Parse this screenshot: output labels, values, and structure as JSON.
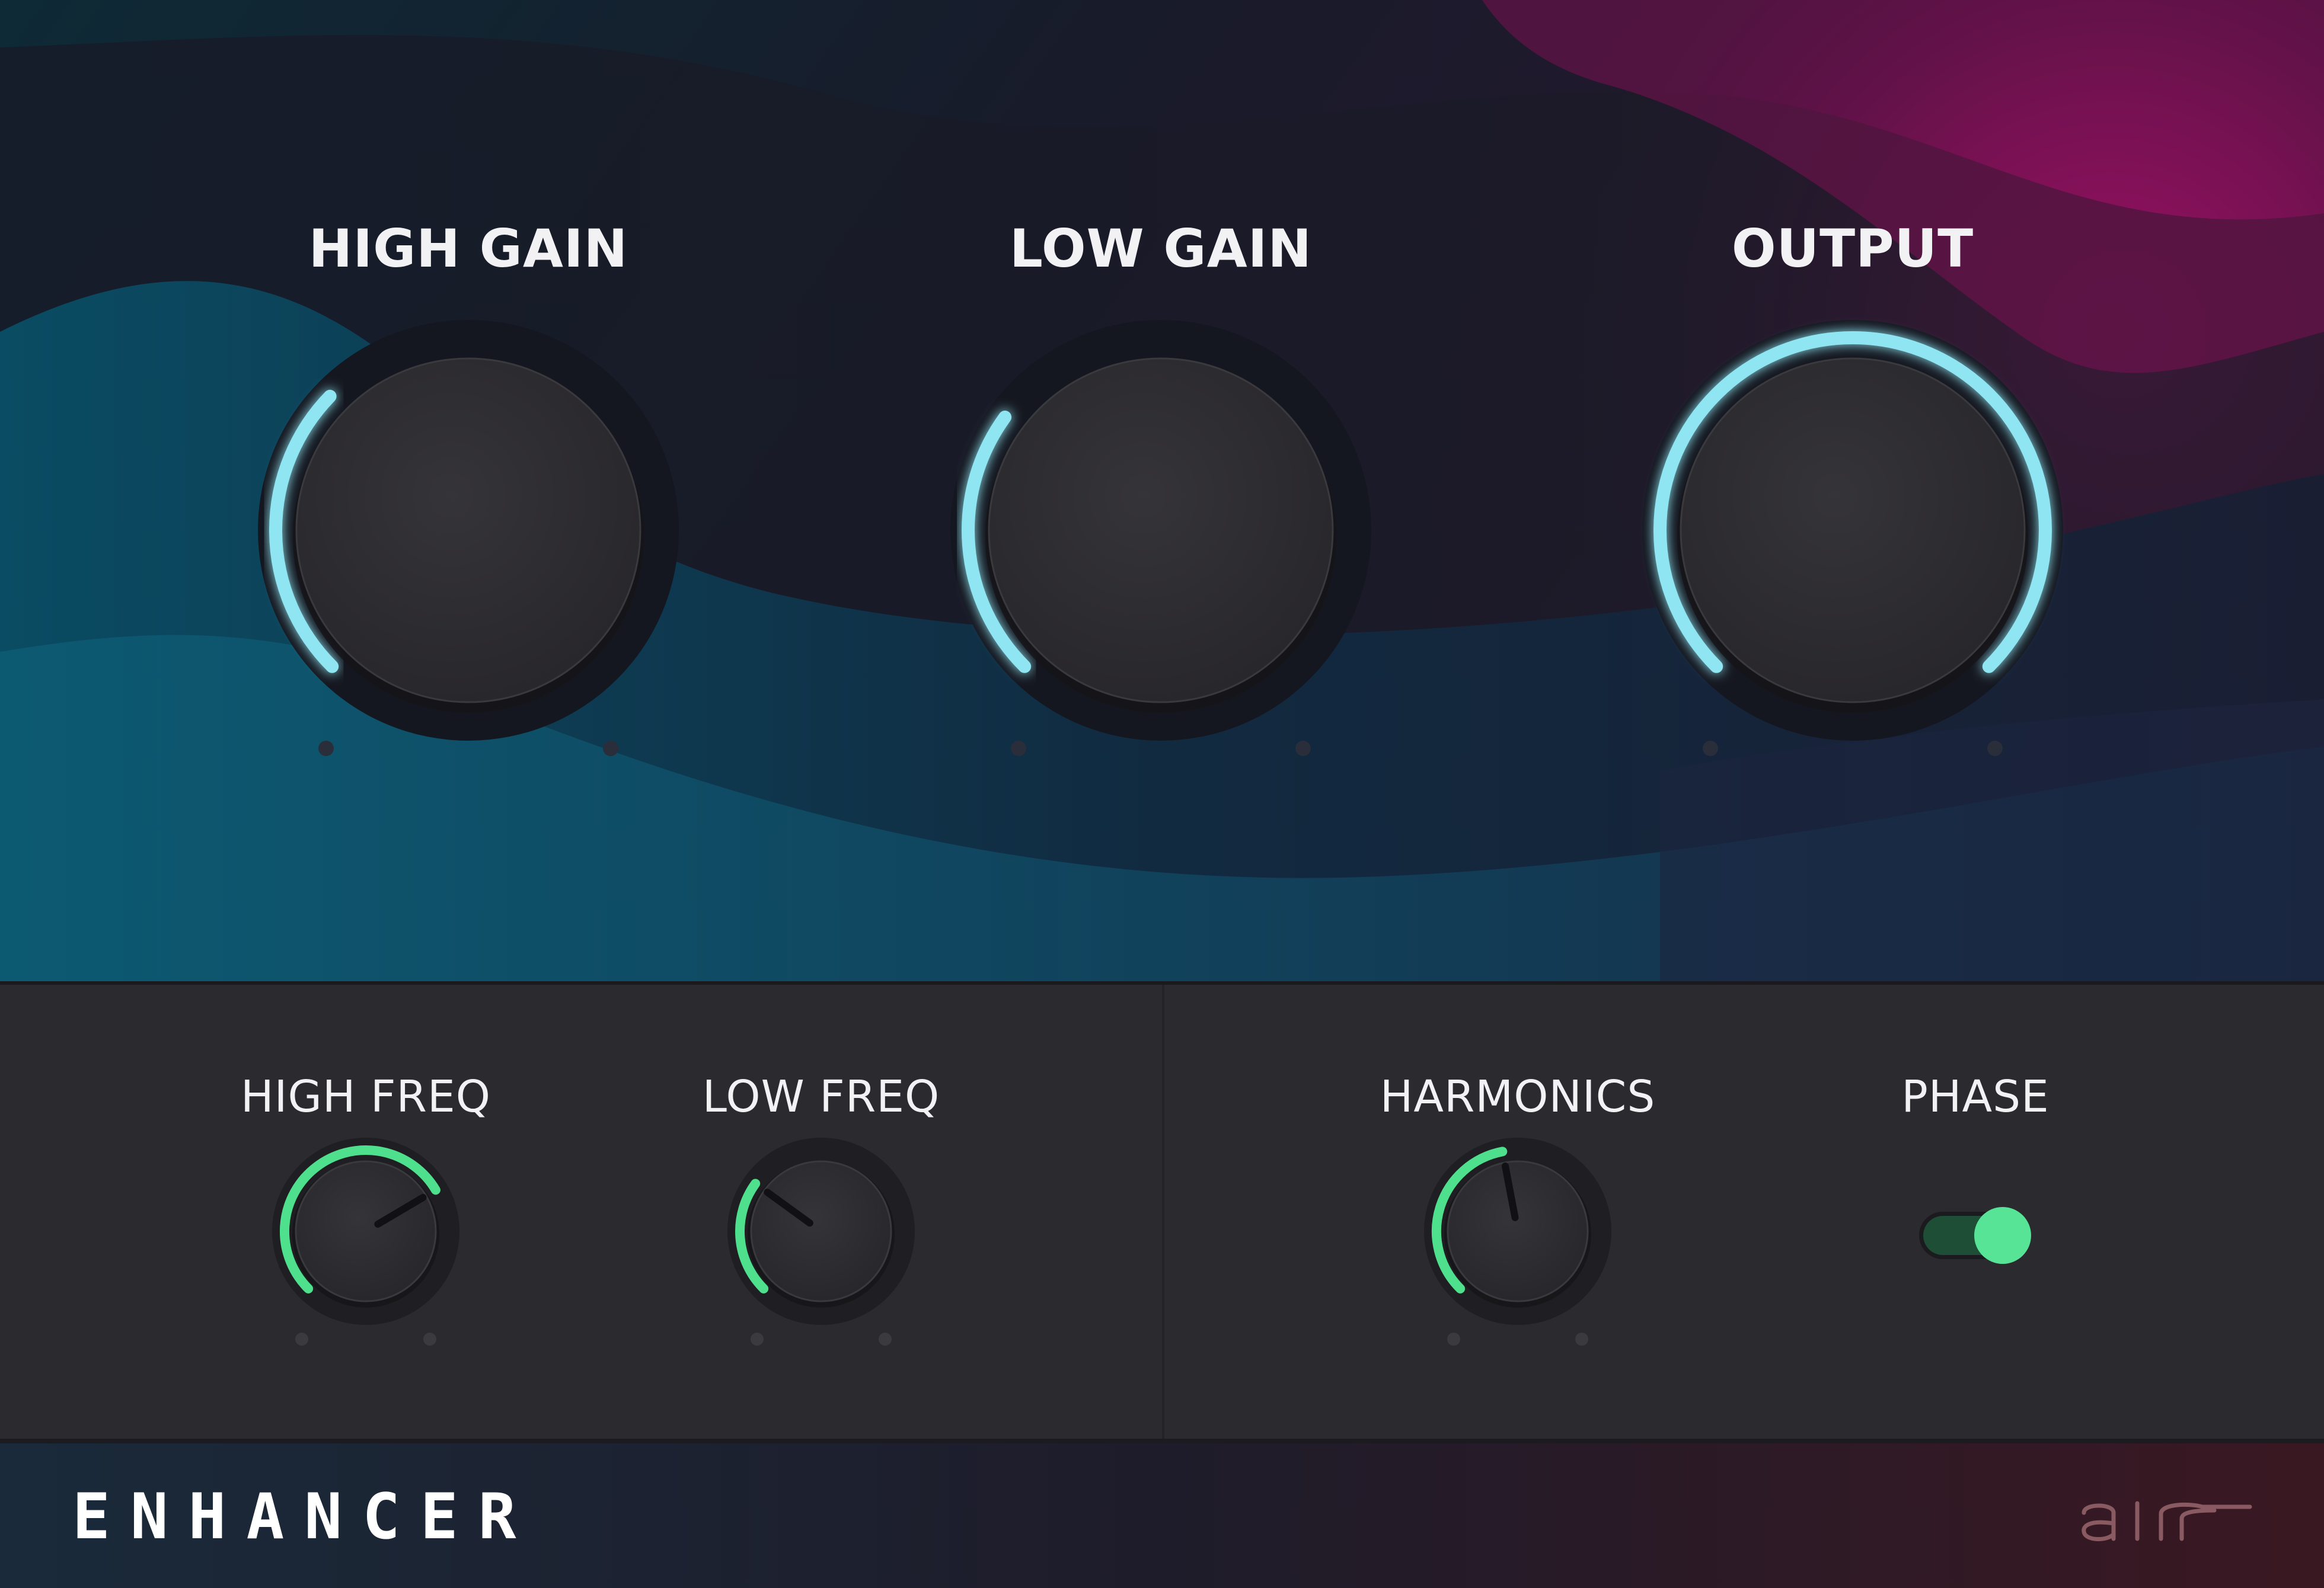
{
  "plugin": {
    "name": "ENHANCER",
    "brand": "air-logo"
  },
  "main_controls": {
    "high_gain": {
      "label": "HIGH GAIN",
      "value_fraction": 0.33
    },
    "low_gain": {
      "label": "LOW GAIN",
      "value_fraction": 0.3
    },
    "output": {
      "label": "OUTPUT",
      "value_fraction": 1.0
    }
  },
  "secondary_controls": {
    "high_freq": {
      "label": "HIGH FREQ",
      "value_fraction": 0.72
    },
    "low_freq": {
      "label": "LOW FREQ",
      "value_fraction": 0.3
    },
    "harmonics": {
      "label": "HARMONICS",
      "value_fraction": 0.46
    },
    "phase": {
      "label": "PHASE",
      "enabled": true
    }
  },
  "colors": {
    "big_arc": "#8fe6f2",
    "small_arc": "#4fe08e",
    "knob_cap": "#2c2b2f",
    "panel": "#2b2a2e",
    "toggle_on": "#58e497",
    "magenta_accent": "#b0146f",
    "teal_accent": "#0d5f78"
  }
}
